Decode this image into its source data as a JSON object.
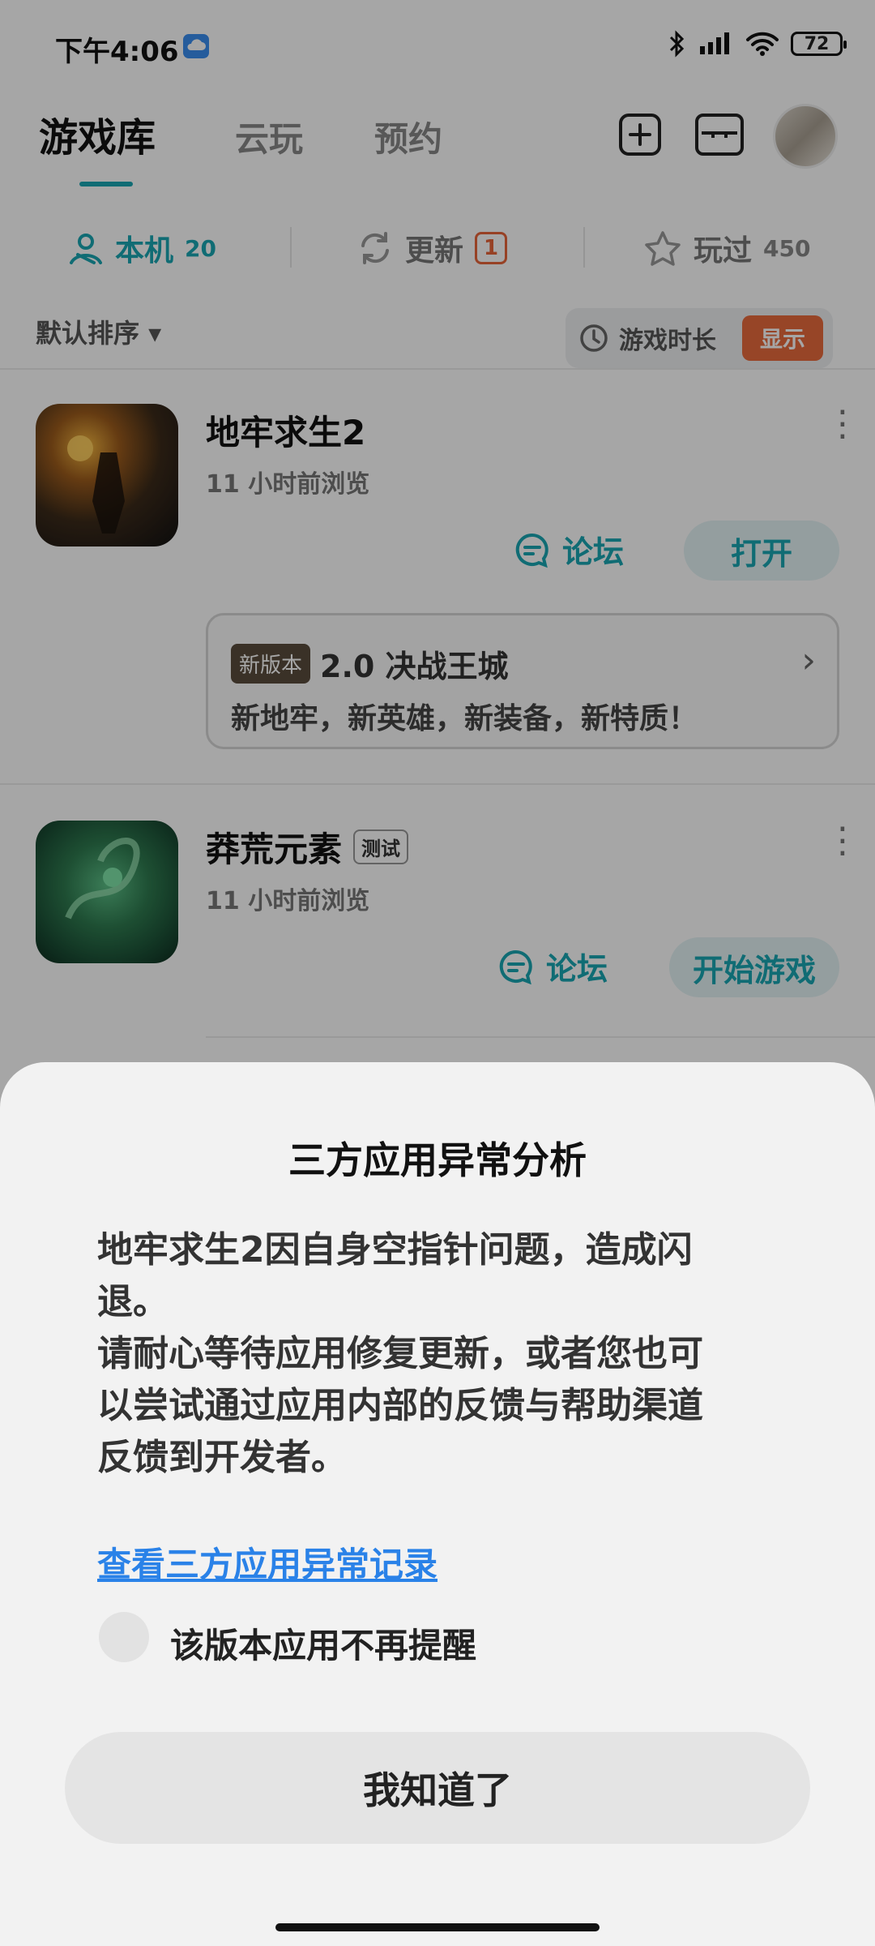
{
  "status_bar": {
    "time": "下午4:06",
    "battery": "72"
  },
  "nav": {
    "tabs": [
      "游戏库",
      "云玩",
      "预约"
    ]
  },
  "filters": {
    "local_label": "本机",
    "local_count": "20",
    "update_label": "更新",
    "update_count": "1",
    "played_label": "玩过",
    "played_count": "450"
  },
  "sort": {
    "label": "默认排序 ▾",
    "playtime_label": "游戏时长",
    "show_label": "显示"
  },
  "games": [
    {
      "name": "地牢求生2",
      "subtitle": "11 小时前浏览",
      "forum_label": "论坛",
      "action_label": "打开",
      "news_tag": "新版本",
      "news_title": "2.0 决战王城",
      "news_desc": "新地牢，新英雄，新装备，新特质！"
    },
    {
      "name": "莽荒元素",
      "tag": "测试",
      "subtitle": "11 小时前浏览",
      "forum_label": "论坛",
      "action_label": "开始游戏"
    }
  ],
  "dialog": {
    "title": "三方应用异常分析",
    "message": "地牢求生2因自身空指针问题，造成闪\n退。\n请耐心等待应用修复更新，或者您也可\n以尝试通过应用内部的反馈与帮助渠道\n反馈到开发者。",
    "link": "查看三方应用异常记录",
    "checkbox_label": "该版本应用不再提醒",
    "checkbox_checked": false,
    "button": "我知道了"
  },
  "colors": {
    "accent": "#1aa7b2",
    "link": "#2a82e8",
    "badge": "#e96a3c"
  }
}
